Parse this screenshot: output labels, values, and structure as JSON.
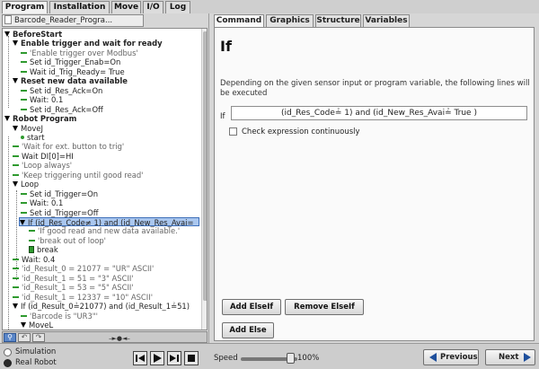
{
  "top_tabs": [
    "Program",
    "Installation",
    "Move",
    "I/O",
    "Log"
  ],
  "file_tab": "Barcode_Reader_Progra...",
  "tree": [
    {
      "label": "BeforeStart",
      "icon": "tri",
      "bold": true
    },
    {
      "label": "Enable trigger and wait for ready",
      "icon": "tri",
      "bold": true
    },
    {
      "label": "'Enable trigger over Modbus'",
      "icon": "dash",
      "comment": true
    },
    {
      "label": "Set id_Trigger_Enab=On",
      "icon": "dash"
    },
    {
      "label": "Wait id_Trig_Ready= True",
      "icon": "dash"
    },
    {
      "label": "Reset new data available",
      "icon": "tri",
      "bold": true
    },
    {
      "label": "Set id_Res_Ack=On",
      "icon": "dash"
    },
    {
      "label": "Wait: 0.1",
      "icon": "dash"
    },
    {
      "label": "Set id_Res_Ack=Off",
      "icon": "dash"
    },
    {
      "label": "Robot Program",
      "icon": "tri",
      "bold": true
    },
    {
      "label": "MoveJ",
      "icon": "tri"
    },
    {
      "label": "start",
      "icon": "dot"
    },
    {
      "label": "'Wait for ext. button to trig'",
      "icon": "dash",
      "comment": true
    },
    {
      "label": "Wait DI[0]=HI",
      "icon": "dash"
    },
    {
      "label": "'Loop always'",
      "icon": "dash",
      "comment": true
    },
    {
      "label": "'Keep triggering until good read'",
      "icon": "dash",
      "comment": true
    },
    {
      "label": "Loop",
      "icon": "tri"
    },
    {
      "label": "Set id_Trigger=On",
      "icon": "dash"
    },
    {
      "label": "Wait: 0.1",
      "icon": "dash"
    },
    {
      "label": "Set id_Trigger=Off",
      "icon": "dash"
    },
    {
      "label": "If (id_Res_Code≠ 1) and (id_New_Res_Avai=",
      "icon": "tri",
      "selected": true
    },
    {
      "label": "'If good read and new data available.'",
      "icon": "dash",
      "comment": true
    },
    {
      "label": "'break out of loop'",
      "icon": "dash",
      "comment": true
    },
    {
      "label": "break",
      "icon": "box"
    },
    {
      "label": "Wait: 0.4",
      "icon": "dash"
    },
    {
      "label": "'id_Result_0 = 21077 = \"UR\" ASCII'",
      "icon": "dash",
      "comment": true
    },
    {
      "label": "'id_Result_1 = 51 = \"3\" ASCII'",
      "icon": "dash",
      "comment": true
    },
    {
      "label": "'id_Result_1 = 53 = \"5\" ASCII'",
      "icon": "dash",
      "comment": true
    },
    {
      "label": "'id_Result_1 = 12337 = \"10\" ASCII'",
      "icon": "dash",
      "comment": true
    },
    {
      "label": "If (id_Result_0≟21077) and (id_Result_1≟51)",
      "icon": "tri"
    },
    {
      "label": "'Barcode is \"UR3\"'",
      "icon": "dash",
      "comment": true
    },
    {
      "label": "MoveL",
      "icon": "tri"
    }
  ],
  "sub_tabs": [
    "Command",
    "Graphics",
    "Structure",
    "Variables"
  ],
  "command": {
    "title": "If",
    "description": "Depending on the given sensor input or program variable, the following lines will be executed",
    "if_label": "If",
    "expression": "(id_Res_Code≟ 1) and (id_New_Res_Avai≟ True )",
    "check_label": "Check expression continuously",
    "add_elseif": "Add ElseIf",
    "remove_elseif": "Remove ElseIf",
    "add_else": "Add Else"
  },
  "bottom": {
    "simulation": "Simulation",
    "real_robot": "Real Robot",
    "speed_label": "Speed",
    "speed_value": "100%",
    "speed_fraction": 1.0,
    "previous": "Previous",
    "next": "Next"
  }
}
